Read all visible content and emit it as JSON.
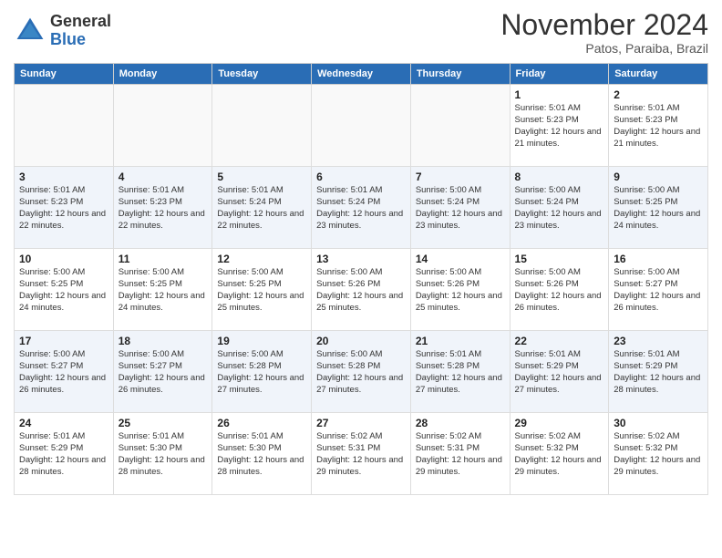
{
  "logo": {
    "general": "General",
    "blue": "Blue"
  },
  "title": "November 2024",
  "location": "Patos, Paraiba, Brazil",
  "days_of_week": [
    "Sunday",
    "Monday",
    "Tuesday",
    "Wednesday",
    "Thursday",
    "Friday",
    "Saturday"
  ],
  "weeks": [
    [
      {
        "day": "",
        "info": ""
      },
      {
        "day": "",
        "info": ""
      },
      {
        "day": "",
        "info": ""
      },
      {
        "day": "",
        "info": ""
      },
      {
        "day": "",
        "info": ""
      },
      {
        "day": "1",
        "info": "Sunrise: 5:01 AM\nSunset: 5:23 PM\nDaylight: 12 hours and 21 minutes."
      },
      {
        "day": "2",
        "info": "Sunrise: 5:01 AM\nSunset: 5:23 PM\nDaylight: 12 hours and 21 minutes."
      }
    ],
    [
      {
        "day": "3",
        "info": "Sunrise: 5:01 AM\nSunset: 5:23 PM\nDaylight: 12 hours and 22 minutes."
      },
      {
        "day": "4",
        "info": "Sunrise: 5:01 AM\nSunset: 5:23 PM\nDaylight: 12 hours and 22 minutes."
      },
      {
        "day": "5",
        "info": "Sunrise: 5:01 AM\nSunset: 5:24 PM\nDaylight: 12 hours and 22 minutes."
      },
      {
        "day": "6",
        "info": "Sunrise: 5:01 AM\nSunset: 5:24 PM\nDaylight: 12 hours and 23 minutes."
      },
      {
        "day": "7",
        "info": "Sunrise: 5:00 AM\nSunset: 5:24 PM\nDaylight: 12 hours and 23 minutes."
      },
      {
        "day": "8",
        "info": "Sunrise: 5:00 AM\nSunset: 5:24 PM\nDaylight: 12 hours and 23 minutes."
      },
      {
        "day": "9",
        "info": "Sunrise: 5:00 AM\nSunset: 5:25 PM\nDaylight: 12 hours and 24 minutes."
      }
    ],
    [
      {
        "day": "10",
        "info": "Sunrise: 5:00 AM\nSunset: 5:25 PM\nDaylight: 12 hours and 24 minutes."
      },
      {
        "day": "11",
        "info": "Sunrise: 5:00 AM\nSunset: 5:25 PM\nDaylight: 12 hours and 24 minutes."
      },
      {
        "day": "12",
        "info": "Sunrise: 5:00 AM\nSunset: 5:25 PM\nDaylight: 12 hours and 25 minutes."
      },
      {
        "day": "13",
        "info": "Sunrise: 5:00 AM\nSunset: 5:26 PM\nDaylight: 12 hours and 25 minutes."
      },
      {
        "day": "14",
        "info": "Sunrise: 5:00 AM\nSunset: 5:26 PM\nDaylight: 12 hours and 25 minutes."
      },
      {
        "day": "15",
        "info": "Sunrise: 5:00 AM\nSunset: 5:26 PM\nDaylight: 12 hours and 26 minutes."
      },
      {
        "day": "16",
        "info": "Sunrise: 5:00 AM\nSunset: 5:27 PM\nDaylight: 12 hours and 26 minutes."
      }
    ],
    [
      {
        "day": "17",
        "info": "Sunrise: 5:00 AM\nSunset: 5:27 PM\nDaylight: 12 hours and 26 minutes."
      },
      {
        "day": "18",
        "info": "Sunrise: 5:00 AM\nSunset: 5:27 PM\nDaylight: 12 hours and 26 minutes."
      },
      {
        "day": "19",
        "info": "Sunrise: 5:00 AM\nSunset: 5:28 PM\nDaylight: 12 hours and 27 minutes."
      },
      {
        "day": "20",
        "info": "Sunrise: 5:00 AM\nSunset: 5:28 PM\nDaylight: 12 hours and 27 minutes."
      },
      {
        "day": "21",
        "info": "Sunrise: 5:01 AM\nSunset: 5:28 PM\nDaylight: 12 hours and 27 minutes."
      },
      {
        "day": "22",
        "info": "Sunrise: 5:01 AM\nSunset: 5:29 PM\nDaylight: 12 hours and 27 minutes."
      },
      {
        "day": "23",
        "info": "Sunrise: 5:01 AM\nSunset: 5:29 PM\nDaylight: 12 hours and 28 minutes."
      }
    ],
    [
      {
        "day": "24",
        "info": "Sunrise: 5:01 AM\nSunset: 5:29 PM\nDaylight: 12 hours and 28 minutes."
      },
      {
        "day": "25",
        "info": "Sunrise: 5:01 AM\nSunset: 5:30 PM\nDaylight: 12 hours and 28 minutes."
      },
      {
        "day": "26",
        "info": "Sunrise: 5:01 AM\nSunset: 5:30 PM\nDaylight: 12 hours and 28 minutes."
      },
      {
        "day": "27",
        "info": "Sunrise: 5:02 AM\nSunset: 5:31 PM\nDaylight: 12 hours and 29 minutes."
      },
      {
        "day": "28",
        "info": "Sunrise: 5:02 AM\nSunset: 5:31 PM\nDaylight: 12 hours and 29 minutes."
      },
      {
        "day": "29",
        "info": "Sunrise: 5:02 AM\nSunset: 5:32 PM\nDaylight: 12 hours and 29 minutes."
      },
      {
        "day": "30",
        "info": "Sunrise: 5:02 AM\nSunset: 5:32 PM\nDaylight: 12 hours and 29 minutes."
      }
    ]
  ]
}
